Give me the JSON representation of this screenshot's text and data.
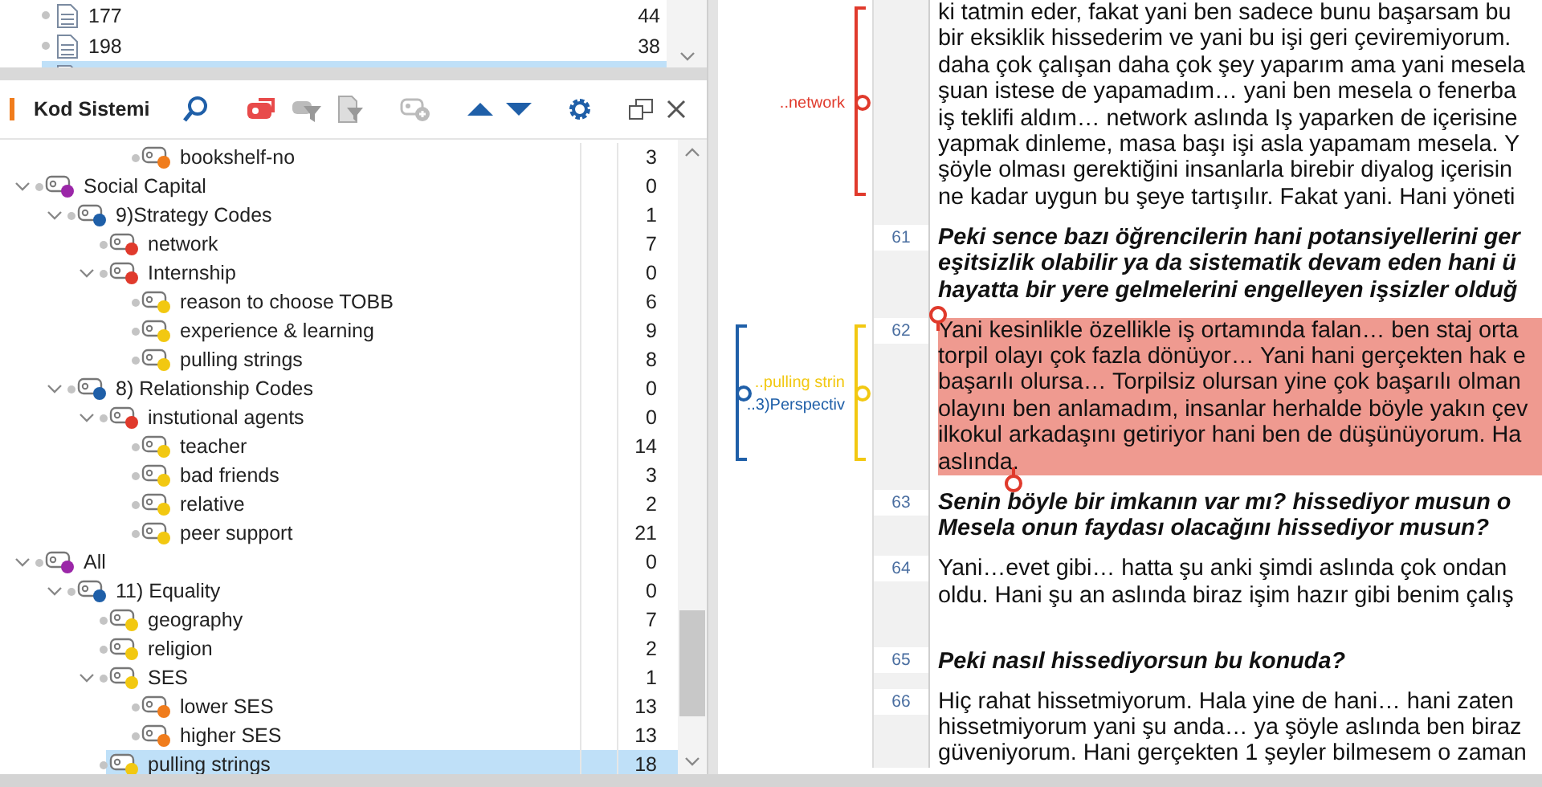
{
  "documents": [
    {
      "name": "177",
      "count": "44",
      "selected": false
    },
    {
      "name": "198",
      "count": "38",
      "selected": false
    },
    {
      "selected": true
    }
  ],
  "code_system": {
    "title": "Kod Sistemi",
    "partial_rows": [
      {
        "name": "bookshelf-no",
        "count": "3",
        "color": "#f07c1c",
        "selected": false
      }
    ],
    "tree": [
      {
        "name": "Social Capital",
        "count": "0",
        "color": "#9b27a8",
        "expanded": true,
        "selected": false,
        "children": [
          {
            "name": "9)Strategy Codes",
            "count": "1",
            "color": "#1f5fa8",
            "expanded": true,
            "selected": false,
            "children": [
              {
                "name": "network",
                "count": "7",
                "color": "#e03a2c",
                "selected": false
              },
              {
                "name": "Internship",
                "count": "0",
                "color": "#e03a2c",
                "expanded": true,
                "selected": false,
                "children": [
                  {
                    "name": "reason to choose TOBB",
                    "count": "6",
                    "color": "#f2c811",
                    "selected": false
                  },
                  {
                    "name": "experience & learning",
                    "count": "9",
                    "color": "#f2c811",
                    "selected": false
                  },
                  {
                    "name": "pulling strings",
                    "count": "8",
                    "color": "#f2c811",
                    "selected": false
                  }
                ]
              }
            ]
          },
          {
            "name": "8) Relationship Codes",
            "count": "0",
            "color": "#1f5fa8",
            "expanded": true,
            "selected": false,
            "children": [
              {
                "name": "instutional agents",
                "count": "0",
                "color": "#e03a2c",
                "expanded": true,
                "selected": false,
                "children": [
                  {
                    "name": "teacher",
                    "count": "14",
                    "color": "#f2c811",
                    "selected": false
                  },
                  {
                    "name": "bad friends",
                    "count": "3",
                    "color": "#f2c811",
                    "selected": false
                  },
                  {
                    "name": "relative",
                    "count": "2",
                    "color": "#f2c811",
                    "selected": false
                  },
                  {
                    "name": "peer support",
                    "count": "21",
                    "color": "#f2c811",
                    "selected": false
                  }
                ]
              }
            ]
          }
        ]
      },
      {
        "name": "All",
        "count": "0",
        "color": "#9b27a8",
        "expanded": true,
        "selected": false,
        "children": [
          {
            "name": "11) Equality",
            "count": "0",
            "color": "#1f5fa8",
            "expanded": true,
            "selected": false,
            "children": [
              {
                "name": "geography",
                "count": "7",
                "color": "#f2c811",
                "selected": false
              },
              {
                "name": "religion",
                "count": "2",
                "color": "#f2c811",
                "selected": false
              },
              {
                "name": "SES",
                "count": "1",
                "color": "#f2c811",
                "expanded": true,
                "selected": false,
                "children": [
                  {
                    "name": "lower SES",
                    "count": "13",
                    "color": "#f07c1c",
                    "selected": false
                  },
                  {
                    "name": "higher SES",
                    "count": "13",
                    "color": "#f07c1c",
                    "selected": false
                  }
                ]
              },
              {
                "name": "pulling strings",
                "count": "18",
                "color": "#f2c811",
                "selected": true
              }
            ]
          }
        ]
      }
    ]
  },
  "document": {
    "paragraphs": [
      {
        "kind": "answer",
        "highlighted": false,
        "codes": [
          {
            "label": "..network",
            "color": "#e03a2c"
          }
        ],
        "lines": [
          "ki tatmin eder, fakat yani ben sadece bunu başarsam bu",
          "bir eksiklik hissederim ve yani bu işi geri çeviremiyorum.",
          "daha çok çalışan daha çok şey yaparım ama yani mesela",
          "şuan istese de yapamadım…  yani ben mesela o fenerba",
          "iş teklifi aldım…  network aslında Iş yaparken de içerisine",
          "yapmak dinleme, masa başı işi asla yapamam mesela. Y",
          "şöyle olması gerektiğini insanlarla birebir diyalog içerisin",
          "ne kadar uygun bu şeye tartışılır. Fakat yani. Hani yöneti"
        ]
      },
      {
        "number": "61",
        "kind": "question",
        "highlighted": false,
        "lines": [
          "Peki sence bazı öğrencilerin hani potansiyellerini ger",
          "eşitsizlik olabilir ya da sistematik devam eden hani ü",
          "hayatta bir yere gelmelerini engelleyen işsizler olduğ"
        ]
      },
      {
        "number": "62",
        "kind": "answer",
        "highlighted": true,
        "codes": [
          {
            "label": "..pulling strin",
            "color": "#f2c811"
          },
          {
            "label": "..3)Perspectiv",
            "color": "#1f5fa8"
          }
        ],
        "lines": [
          "Yani kesinlikle özellikle iş ortamında falan… ben staj orta",
          "torpil olayı çok fazla dönüyor… Yani hani gerçekten hak e",
          "başarılı olursa… Torpilsiz olursan yine çok başarılı olman",
          "olayını ben anlamadım, insanlar herhalde böyle yakın çev",
          "ilkokul arkadaşını getiriyor hani ben de düşünüyorum. Ha",
          "aslında."
        ]
      },
      {
        "number": "63",
        "kind": "question",
        "highlighted": false,
        "lines": [
          "Senin böyle bir imkanın var mı?  hissediyor musun o",
          "Mesela onun faydası olacağını hissediyor musun?"
        ]
      },
      {
        "number": "64",
        "kind": "answer",
        "highlighted": false,
        "lines": [
          "Yani…evet gibi…  hatta şu anki şimdi aslında çok ondan",
          "oldu. Hani şu an aslında biraz işim hazır gibi benim çalış"
        ]
      },
      {
        "number": "65",
        "kind": "question",
        "highlighted": false,
        "lines": [
          "Peki nasıl hissediyorsun bu konuda?"
        ]
      },
      {
        "number": "66",
        "kind": "answer",
        "highlighted": false,
        "lines": [
          "Hiç rahat hissetmiyorum. Hala yine de hani…  hani zaten",
          "hissetmiyorum yani şu anda… ya şöyle aslında ben biraz",
          "güveniyorum. Hani gerçekten 1 şeyler bilmesem o zaman"
        ]
      }
    ]
  }
}
